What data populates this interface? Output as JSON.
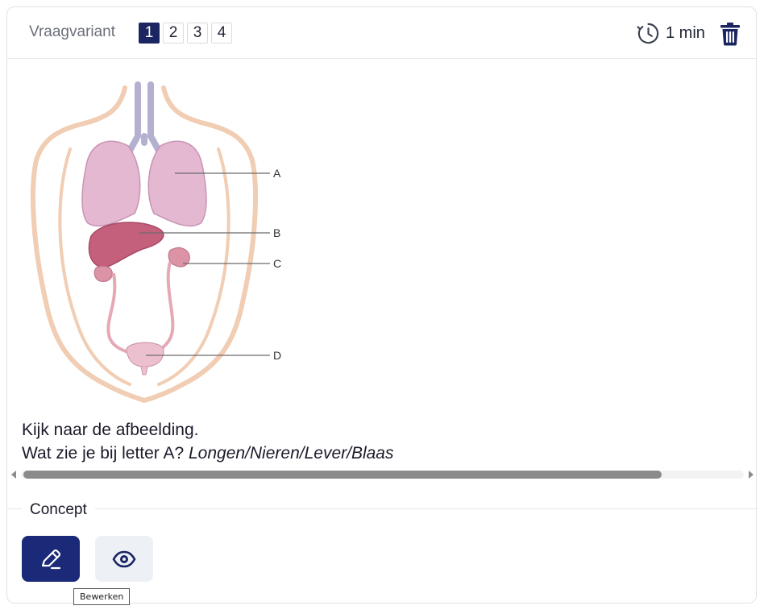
{
  "header": {
    "variant_label": "Vraagvariant",
    "variants": [
      "1",
      "2",
      "3",
      "4"
    ],
    "active_variant": "1",
    "timer_label": "1 min",
    "icons": {
      "timer": "clock-history-icon",
      "delete": "trash-icon"
    }
  },
  "figure": {
    "labels": [
      "A",
      "B",
      "C",
      "D"
    ]
  },
  "question": {
    "line1": "Kijk naar de afbeelding.",
    "line2_prefix": "Wat zie je bij letter A? ",
    "line2_options": "Longen/Nieren/Lever/Blaas"
  },
  "scrollbar": {
    "position": 0
  },
  "concept": {
    "label": "Concept",
    "edit_icon": "pencil-icon",
    "view_icon": "eye-icon",
    "tooltip": "Bewerken"
  },
  "colors": {
    "primary": "#1b2561",
    "edit_button": "#1b2a78",
    "view_button": "#edf1f6"
  }
}
